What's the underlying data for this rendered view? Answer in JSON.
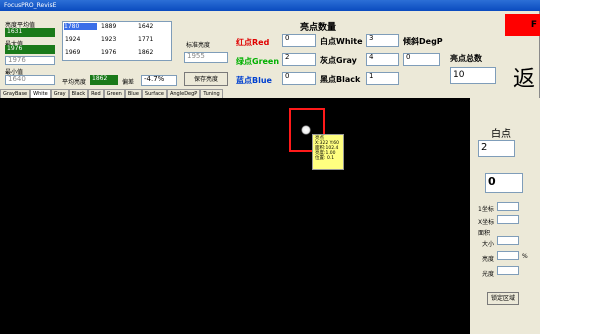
{
  "window": {
    "title": "FocusPRO_RevisE"
  },
  "left_panel": {
    "label_a": "亮度平均值",
    "value_a": "1631",
    "label_b": "最大值",
    "value_b": "1976",
    "label_c": "最小值",
    "value_c": "1640",
    "grid": [
      [
        "1780",
        "1889",
        "1642"
      ],
      [
        "1924",
        "1923",
        "1771"
      ],
      [
        "1969",
        "1976",
        "1862"
      ]
    ],
    "standard_label": "标准亮度",
    "standard_value": "1955",
    "avg_label": "平均亮度",
    "avg_value": "1862",
    "bias_label": "偏差",
    "bias_value": "-4.7%",
    "save_button": "保存亮度"
  },
  "tabs": [
    "GrayBase",
    "White",
    "Gray",
    "Black",
    "Red",
    "Green",
    "Blue",
    "Surface",
    "AngleDegP",
    "Tuning"
  ],
  "active_tab": "White",
  "points": {
    "title": "亮点数量",
    "red_label": "红点Red",
    "red_value": "0",
    "green_label": "绿点Green",
    "green_value": "2",
    "blue_label": "蓝点Blue",
    "blue_value": "0",
    "white_label": "白点White",
    "white_value": "3",
    "gray_label": "灰点Gray",
    "gray_value": "4",
    "black_label": "黑点Black",
    "black_value": "1",
    "deg_label": "倾斜DegP",
    "deg_value": "0",
    "total_label": "亮点总数",
    "total_value": "10"
  },
  "banner": {
    "text": "F"
  },
  "back_glyph": "返",
  "tooltip": {
    "lines": [
      "亮点",
      "X:322  Y:60",
      "面积:102.4",
      "亮度:1.00",
      "位置:  0.1"
    ]
  },
  "right_panel": {
    "title": "白点",
    "count": "2",
    "spinner": "0",
    "labels": [
      "1坐标",
      "X坐标",
      "面积",
      "大小",
      "亮度",
      "光度"
    ],
    "unit": "%",
    "button": "锁定区域"
  },
  "colors": {
    "accent": "#3a6ee8",
    "alert": "#ff0000",
    "select": "#ff1a1a"
  }
}
